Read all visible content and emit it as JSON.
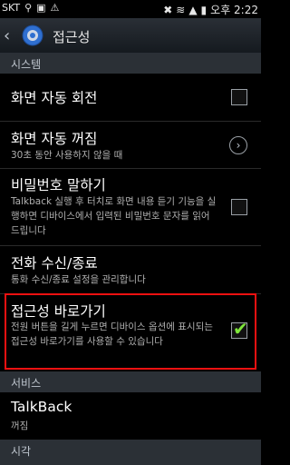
{
  "status": {
    "carrier": "SKT",
    "time": "오후 2:22"
  },
  "header": {
    "title": "접근성"
  },
  "sections": {
    "system": "시스템",
    "services": "서비스",
    "vision": "시각"
  },
  "items": {
    "auto_rotate": {
      "title": "화면 자동 회전",
      "checked": false
    },
    "screen_timeout": {
      "title": "화면 자동 꺼짐",
      "sub": "30초 동안 사용하지 않을 때"
    },
    "speak_passwords": {
      "title": "비밀번호 말하기",
      "sub": "Talkback 실행 후 터치로 화면 내용 듣기 기능을 실행하면 디바이스에서 입력된 비밀번호 문자를 읽어 드립니다",
      "checked": false
    },
    "call_answering": {
      "title": "전화 수신/종료",
      "sub": "통화 수신/종료 설정을 관리합니다"
    },
    "accessibility_shortcut": {
      "title": "접근성 바로가기",
      "sub": "전원 버튼을 길게 누르면 디바이스 옵션에 표시되는 접근성 바로가기를 사용할 수 있습니다",
      "checked": true
    },
    "talkback": {
      "title": "TalkBack",
      "sub": "꺼짐"
    }
  },
  "colors": {
    "highlight": "#ee1111",
    "check": "#7fe63b",
    "section_bg": "#2b3036"
  }
}
